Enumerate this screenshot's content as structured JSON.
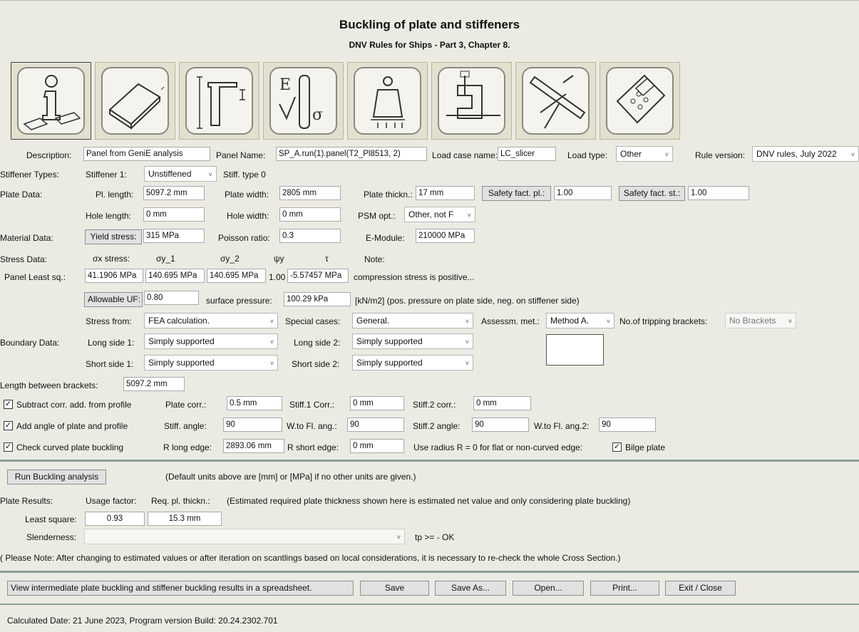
{
  "title": "Buckling of plate and stiffeners",
  "subtitle": "DNV Rules for Ships - Part 3, Chapter 8.",
  "toolbar": {
    "icons": [
      "info-icon",
      "plate-geometry-icon",
      "stiffener-profile-icon",
      "material-properties-icon",
      "load-weight-icon",
      "clamp-boundary-icon",
      "corrosion-measure-icon",
      "calculator-icon"
    ]
  },
  "general": {
    "description_label": "Description:",
    "description_value": "Panel from GeniE analysis",
    "panel_name_label": "Panel Name:",
    "panel_name_value": "SP_A.run(1).panel(T2_Pl8513, 2)",
    "load_case_label": "Load case name:",
    "load_case_value": "LC_slicer",
    "load_type_label": "Load type:",
    "load_type_value": "Other",
    "rule_version_label": "Rule version:",
    "rule_version_value": "DNV rules, July 2022"
  },
  "stiffener": {
    "label": "Stiffener Types:",
    "stiff1_label": "Stiffener 1:",
    "stiff1_value": "Unstiffened",
    "stiff_type": "Stiff. type 0"
  },
  "plate": {
    "label": "Plate Data:",
    "pl_length_label": "Pl. length:",
    "pl_length_value": "5097.2 mm",
    "plate_width_label": "Plate width:",
    "plate_width_value": "2805 mm",
    "plate_thick_label": "Plate thickn.:",
    "plate_thick_value": "17 mm",
    "safety_pl_label": "Safety fact. pl.:",
    "safety_pl_value": "1.00",
    "safety_st_label": "Safety fact. st.:",
    "safety_st_value": "1.00",
    "hole_length_label": "Hole length:",
    "hole_length_value": "0 mm",
    "hole_width_label": "Hole width:",
    "hole_width_value": "0 mm",
    "psm_label": "PSM opt.:",
    "psm_value": "Other, not F"
  },
  "material": {
    "label": "Material Data:",
    "yield_label": "Yield stress:",
    "yield_value": "315 MPa",
    "poisson_label": "Poisson ratio:",
    "poisson_value": "0.3",
    "emodule_label": "E-Module:",
    "emodule_value": "210000 MPa"
  },
  "stress": {
    "label": "Stress Data:",
    "sx_label": "σx stress:",
    "sy1_label": "σy_1",
    "sy2_label": "σy_2",
    "psi_label": "ψy",
    "tau_label": "τ",
    "note_label": "Note:",
    "row_label": "Panel Least sq.:",
    "sx_value": "41.1906 MPa",
    "sy1_value": "140.695 MPa",
    "sy2_value": "140.695 MPa",
    "psi_value": "1.00",
    "tau_value": "-5.57457 MPa",
    "note_text": "compression stress is positive...",
    "allowable_uf_label": "Allowable UF:",
    "allowable_uf_value": "0.80",
    "surface_pressure_label": "surface pressure:",
    "surface_pressure_value": "100.29 kPa",
    "surface_pressure_note": "[kN/m2] (pos. pressure on plate side, neg. on stiffener side)",
    "stress_from_label": "Stress from:",
    "stress_from_value": "FEA calculation.",
    "special_cases_label": "Special cases:",
    "special_cases_value": "General.",
    "assess_label": "Assessm. met.:",
    "assess_value": "Method A.",
    "tripping_label": "No.of tripping brackets:",
    "tripping_value": "No Brackets"
  },
  "boundary": {
    "label": "Boundary Data:",
    "long1_label": "Long side 1:",
    "long1_value": "Simply supported",
    "long2_label": "Long side 2:",
    "long2_value": "Simply supported",
    "short1_label": "Short side 1:",
    "short1_value": "Simply supported",
    "short2_label": "Short side 2:",
    "short2_value": "Simply supported",
    "length_brackets_label": "Length between brackets:",
    "length_brackets_value": "5097.2 mm"
  },
  "corrosion": {
    "subtract_label": "Subtract corr. add. from profile",
    "plate_corr_label": "Plate corr.:",
    "plate_corr_value": "0.5 mm",
    "stiff1_corr_label": "Stiff.1 Corr.:",
    "stiff1_corr_value": "0 mm",
    "stiff2_corr_label": "Stiff.2 corr.:",
    "stiff2_corr_value": "0 mm",
    "add_angle_label": "Add angle of plate and profile",
    "stiff_angle_label": "Stiff. angle:",
    "stiff_angle_value": "90",
    "wto_fl_label": "W.to Fl. ang.:",
    "wto_fl_value": "90",
    "stiff2_angle_label": "Stiff.2 angle:",
    "stiff2_angle_value": "90",
    "wto_fl2_label": "W.to Fl. ang.2:",
    "wto_fl2_value": "90",
    "curved_label": "Check curved plate buckling",
    "r_long_label": "R long edge:",
    "r_long_value": "2893.06 mm",
    "r_short_label": "R short edge:",
    "r_short_value": "0 mm",
    "radius_note": "Use radius R = 0 for flat or non-curved edge:",
    "bilge_label": "Bilge plate"
  },
  "run": {
    "button_label": "Run Buckling analysis",
    "default_units_note": "(Default units above are [mm] or [MPa] if no other units are given.)"
  },
  "results": {
    "label": "Plate Results:",
    "usage_label": "Usage factor:",
    "req_label": "Req. pl. thickn.:",
    "estimate_note": "(Estimated required plate thickness shown here is estimated net value and only considering plate buckling)",
    "least_square_label": "Least square:",
    "usage_value": "0.93",
    "req_value": "15.3 mm",
    "slenderness_label": "Slenderness:",
    "slenderness_value": "",
    "tp_text": "tp >=  -  OK",
    "recheck_note": "( Please Note: After changing to estimated values or after iteration on scantlings based on local considerations, it is necessary to re-check the whole Cross Section.)"
  },
  "actions": {
    "view_label": "View intermediate plate buckling and stiffener buckling results in a spreadsheet.",
    "save_label": "Save",
    "save_as_label": "Save As...",
    "open_label": "Open...",
    "print_label": "Print...",
    "exit_label": "Exit / Close"
  },
  "footer": {
    "status": "Calculated Date: 21 June 2023,   Program version Build: 20.24.2302.701"
  }
}
